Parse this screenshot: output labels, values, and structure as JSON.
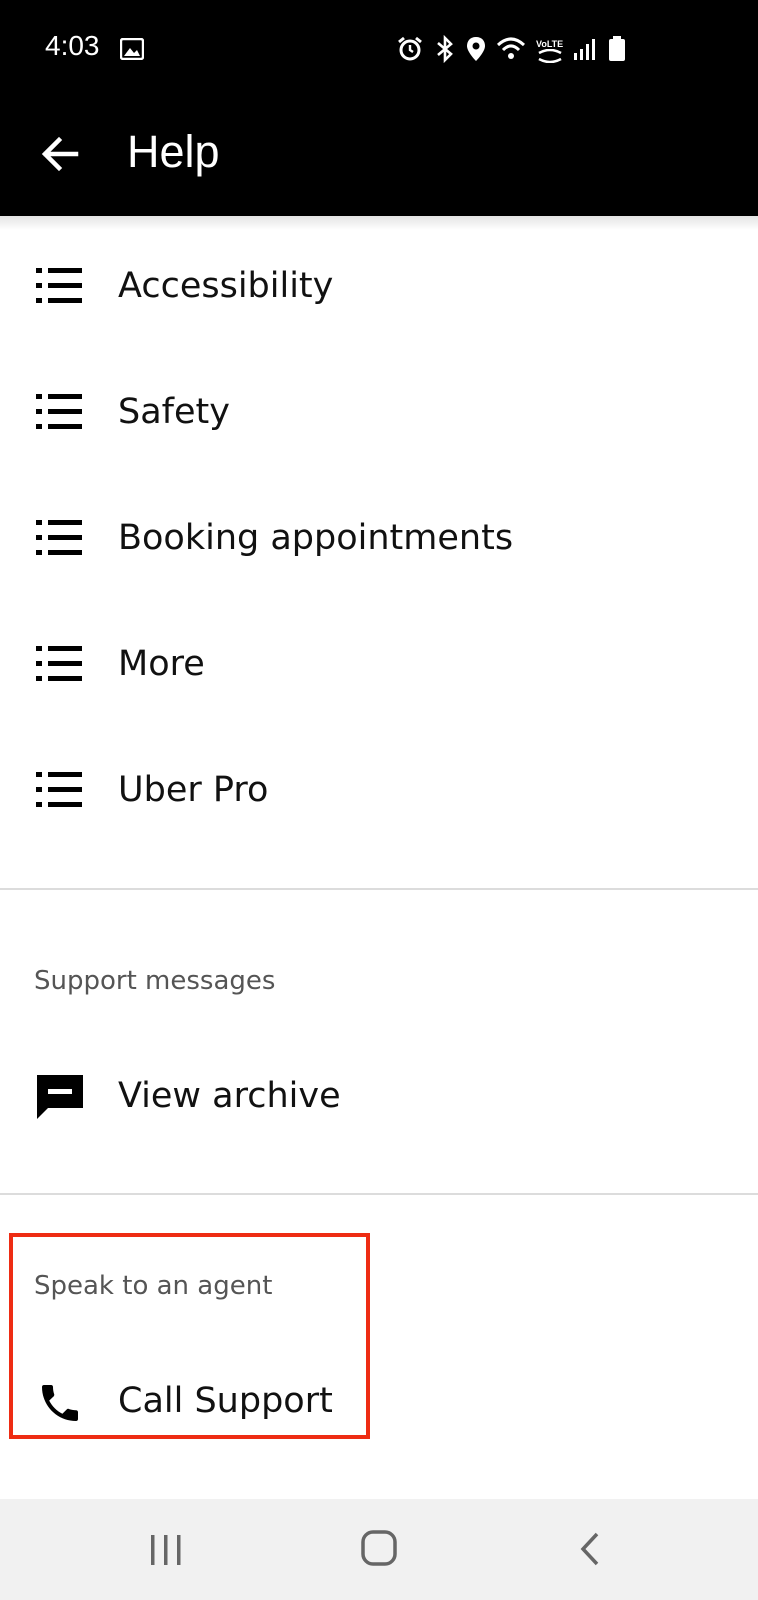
{
  "status_bar": {
    "time": "4:03",
    "icons": [
      "image-icon",
      "alarm-icon",
      "bluetooth-icon",
      "location-icon",
      "wifi-icon",
      "volte-icon",
      "signal-icon",
      "battery-icon"
    ],
    "volte_label": "VoLTE"
  },
  "app_bar": {
    "title": "Help",
    "back_icon": "back-arrow-icon"
  },
  "help_topics": [
    {
      "label": "Accessibility",
      "icon": "list-icon"
    },
    {
      "label": "Safety",
      "icon": "list-icon"
    },
    {
      "label": "Booking appointments",
      "icon": "list-icon"
    },
    {
      "label": "More",
      "icon": "list-icon"
    },
    {
      "label": "Uber Pro",
      "icon": "list-icon"
    }
  ],
  "support_messages": {
    "header": "Support messages",
    "view_archive_label": "View archive",
    "icon": "chat-icon"
  },
  "agent": {
    "header": "Speak to an agent",
    "call_label": "Call Support",
    "icon": "phone-icon"
  },
  "nav_bar": {
    "icons": [
      "recents-icon",
      "home-icon",
      "back-icon"
    ]
  },
  "colors": {
    "header_bg": "#000000",
    "highlight": "#ee2c13",
    "nav_bg": "#f1f1f1"
  }
}
